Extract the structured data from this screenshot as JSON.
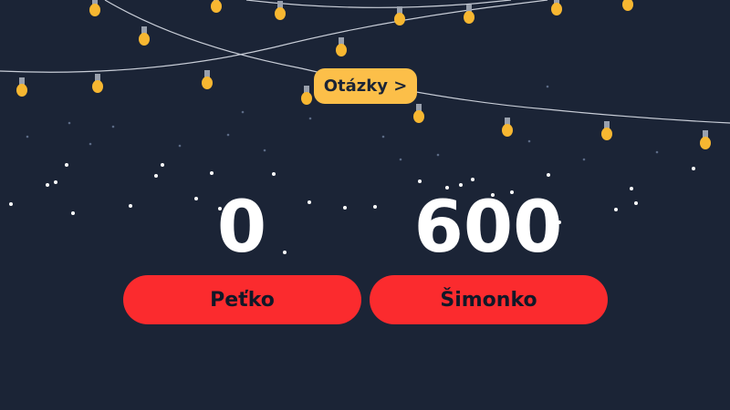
{
  "nav": {
    "questions_label": "Otázky >"
  },
  "teams": [
    {
      "name": "Peťko",
      "score": "0"
    },
    {
      "name": "Šimonko",
      "score": "600"
    }
  ],
  "colors": {
    "background": "#1b2436",
    "accent_yellow": "#fcbf49",
    "team_red": "#fb2b2e",
    "bulb": "#f7b731",
    "wire": "#c9ced8"
  },
  "icons": [
    "string-lights-decoration",
    "snow-dots"
  ]
}
